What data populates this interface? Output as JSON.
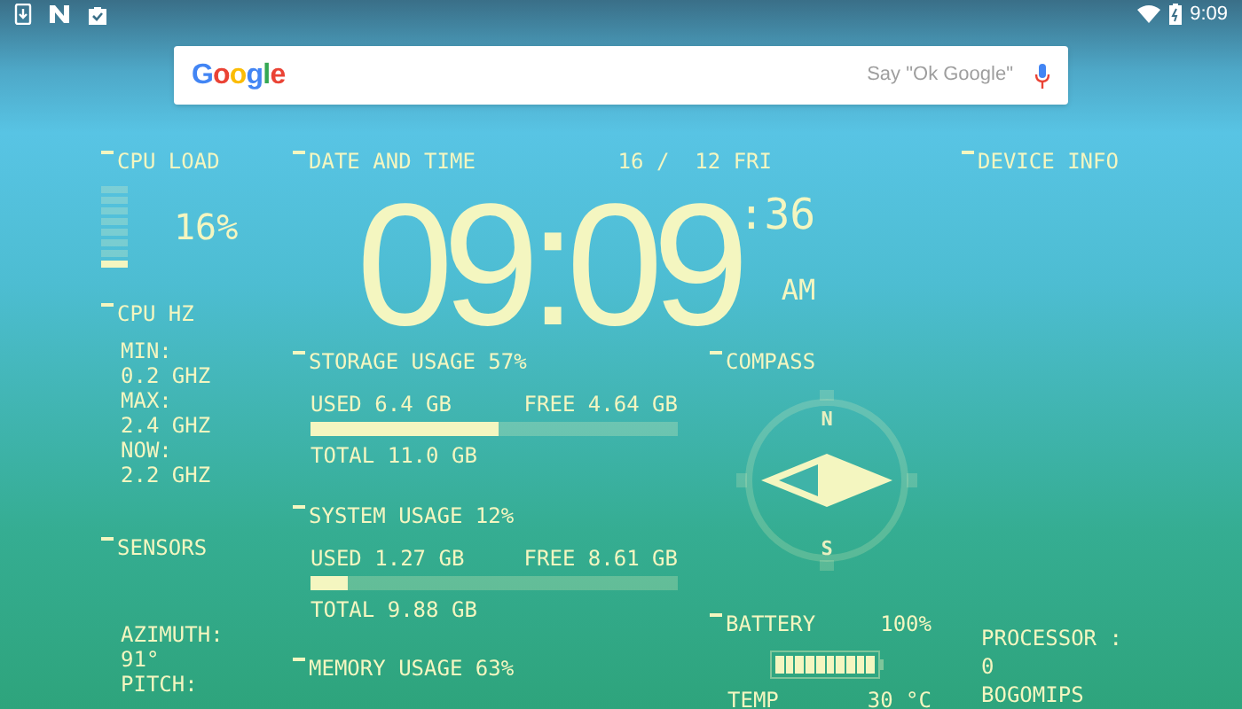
{
  "status_bar": {
    "time": "9:09"
  },
  "search": {
    "logo": "Google",
    "placeholder": "Say \"Ok Google\""
  },
  "cpu_load": {
    "title": "CPU LOAD",
    "level": 0.16,
    "reading": "16%"
  },
  "cpu_hz": {
    "title": "CPU HZ",
    "lines": [
      "MIN:",
      "0.2 GHZ",
      "MAX:",
      "2.4 GHZ",
      "NOW:",
      "2.2 GHZ"
    ]
  },
  "sensors": {
    "title": "SENSORS",
    "lines": [
      "AZIMUTH:",
      "91°",
      "PITCH:"
    ]
  },
  "date_time": {
    "title": "DATE AND TIME",
    "date": "16 /  12 FRI",
    "time": "09:09",
    "seconds": ":36",
    "period": "AM"
  },
  "usage": [
    {
      "title": "STORAGE USAGE 57%",
      "used": "USED 6.4 GB",
      "free": "FREE 4.64 GB",
      "level": 0.51,
      "total": "TOTAL 11.0 GB"
    },
    {
      "title": "SYSTEM USAGE  12%",
      "used": "USED 1.27 GB",
      "free": "FREE 8.61 GB",
      "level": 0.1,
      "total": "TOTAL 9.88 GB"
    },
    {
      "title": "MEMORY USAGE 63%"
    }
  ],
  "compass": {
    "title": "COMPASS",
    "north": "N",
    "south": "S"
  },
  "battery": {
    "title": "BATTERY",
    "reading": "100%",
    "level": 1.0,
    "temp_label": "TEMP",
    "temp": "30 °C"
  },
  "device_info": {
    "title": "DEVICE INFO",
    "lines": [
      "PROCESSOR :",
      "0",
      "BOGOMIPS"
    ]
  }
}
